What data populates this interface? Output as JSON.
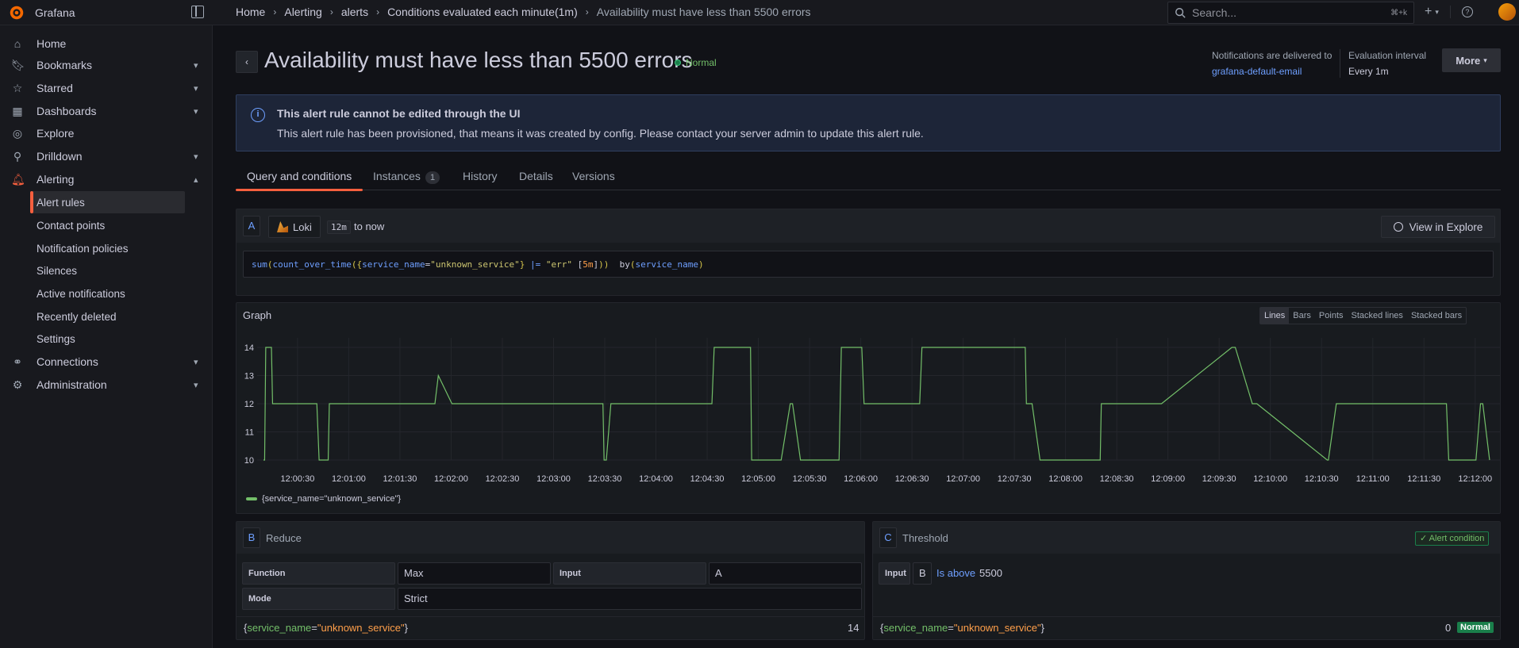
{
  "app": {
    "name": "Grafana"
  },
  "breadcrumbs": [
    "Home",
    "Alerting",
    "alerts",
    "Conditions evaluated each minute(1m)",
    "Availability must have less than 5500 errors"
  ],
  "search": {
    "placeholder": "Search...",
    "shortcut": "⌘+k"
  },
  "sidebar": {
    "items": [
      {
        "label": "Home",
        "icon": "home-icon"
      },
      {
        "label": "Bookmarks",
        "icon": "bookmark-icon"
      },
      {
        "label": "Starred",
        "icon": "star-icon"
      },
      {
        "label": "Dashboards",
        "icon": "apps-icon"
      },
      {
        "label": "Explore",
        "icon": "compass-icon"
      },
      {
        "label": "Drilldown",
        "icon": "microscope-icon"
      },
      {
        "label": "Alerting",
        "icon": "bell-icon"
      },
      {
        "label": "Connections",
        "icon": "plug-icon"
      },
      {
        "label": "Administration",
        "icon": "cog-icon"
      }
    ],
    "alerting_sub": [
      "Alert rules",
      "Contact points",
      "Notification policies",
      "Silences",
      "Active notifications",
      "Recently deleted",
      "Settings"
    ]
  },
  "header": {
    "title": "Availability must have less than 5500 errors",
    "state": "Normal",
    "notif_label": "Notifications are delivered to",
    "notif_value": "grafana-default-email",
    "eval_label": "Evaluation interval",
    "eval_value": "Every 1m",
    "more": "More"
  },
  "banner": {
    "title": "This alert rule cannot be edited through the UI",
    "text": "This alert rule has been provisioned, that means it was created by config. Please contact your server admin to update this alert rule."
  },
  "tabs": [
    {
      "label": "Query and conditions"
    },
    {
      "label": "Instances",
      "count": "1"
    },
    {
      "label": "History"
    },
    {
      "label": "Details"
    },
    {
      "label": "Versions"
    }
  ],
  "query": {
    "ref": "A",
    "datasource": "Loki",
    "range": "12m",
    "to": "to now",
    "explore": "View in Explore"
  },
  "graph": {
    "title": "Graph",
    "types": [
      "Lines",
      "Bars",
      "Points",
      "Stacked lines",
      "Stacked bars"
    ],
    "active_type": "Lines"
  },
  "chart_data": {
    "type": "line",
    "x_ticks": [
      "12:00:30",
      "12:01:00",
      "12:01:30",
      "12:02:00",
      "12:02:30",
      "12:03:00",
      "12:03:30",
      "12:04:00",
      "12:04:30",
      "12:05:00",
      "12:05:30",
      "12:06:00",
      "12:06:30",
      "12:07:00",
      "12:07:30",
      "12:08:00",
      "12:08:30",
      "12:09:00",
      "12:09:30",
      "12:10:00",
      "12:10:30",
      "12:11:00",
      "12:11:30",
      "12:12:00"
    ],
    "y_ticks": [
      10,
      11,
      12,
      13,
      14
    ],
    "ylim": [
      10,
      14
    ],
    "series": [
      {
        "name": "{service_name=\"unknown_service\"}",
        "color": "#73bf69",
        "x_seconds": [
          0,
          1,
          2,
          7,
          8,
          47,
          49,
          57,
          58,
          86,
          88,
          151,
          154,
          166,
          168,
          299,
          300,
          302,
          306,
          342,
          344,
          351,
          357,
          395,
          397,
          429,
          430,
          456,
          464,
          466,
          473,
          478,
          490,
          507,
          509,
          527,
          529,
          562,
          565,
          578,
          580,
          671,
          672,
          677,
          684,
          737,
          738,
          748,
          753,
          784,
          791,
          853,
          856,
          871,
          875,
          937,
          938,
          945,
          948,
          997,
          999,
          1042,
          1044,
          1068,
          1072,
          1074,
          1080
        ],
        "values": [
          10,
          10,
          14,
          14,
          12,
          12,
          10,
          10,
          12,
          12,
          12,
          12,
          13,
          12,
          12,
          12,
          10,
          10,
          12,
          12,
          12,
          12,
          12,
          12,
          14,
          14,
          10,
          10,
          12,
          12,
          10,
          10,
          10,
          10,
          14,
          14,
          12,
          12,
          12,
          12,
          14,
          14,
          12,
          12,
          10,
          10,
          12,
          12,
          12,
          12,
          12,
          14,
          14,
          12,
          12,
          10,
          10,
          12,
          12,
          12,
          12,
          12,
          10,
          10,
          12,
          12,
          10
        ]
      }
    ]
  },
  "reduce": {
    "ref": "B",
    "name": "Reduce",
    "function_label": "Function",
    "function_value": "Max",
    "input_label": "Input",
    "input_value": "A",
    "mode_label": "Mode",
    "mode_value": "Strict",
    "result_key": "service_name",
    "result_val": "unknown_service",
    "result_value": "14"
  },
  "threshold": {
    "ref": "C",
    "name": "Threshold",
    "condition_badge": "Alert condition",
    "input_label": "Input",
    "input_value": "B",
    "operator": "Is above",
    "value": "5500",
    "result_key": "service_name",
    "result_val": "unknown_service",
    "result_value": "0",
    "result_state": "Normal"
  }
}
